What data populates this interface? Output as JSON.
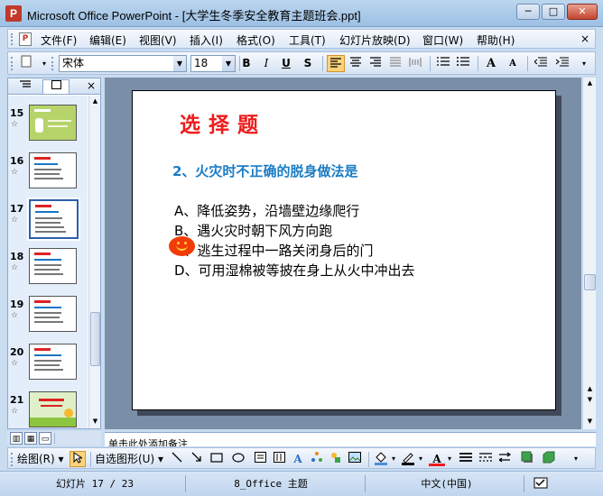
{
  "window": {
    "title": "Microsoft Office PowerPoint - [大学生冬季安全教育主题班会.ppt]",
    "app_icon_letter": "P",
    "minimize": "─",
    "maximize": "□",
    "close": "✕"
  },
  "menubar": {
    "items": [
      "文件(F)",
      "编辑(E)",
      "视图(V)",
      "插入(I)",
      "格式(O)",
      "工具(T)",
      "幻灯片放映(D)",
      "窗口(W)",
      "帮助(H)"
    ],
    "close_glyph": "×"
  },
  "format_toolbar": {
    "font_name": "宋体",
    "font_size": "18",
    "bold": "B",
    "italic": "I",
    "underline": "U",
    "shadow": "S",
    "grow_font": "A",
    "shrink_font": "A"
  },
  "outline_pane": {
    "close_glyph": "×",
    "slides": [
      {
        "number": "15"
      },
      {
        "number": "16"
      },
      {
        "number": "17",
        "selected": true
      },
      {
        "number": "18"
      },
      {
        "number": "19"
      },
      {
        "number": "20"
      },
      {
        "number": "21"
      }
    ],
    "star_glyph": "☆"
  },
  "slide": {
    "title": "选择题",
    "question": "2、火灾时不正确的脱身做法是",
    "options": [
      "A、降低姿势，沿墙壁边缘爬行",
      "B、遇火灾时朝下风方向跑",
      "C、逃生过程中一路关闭身后的门",
      "D、可用湿棉被等披在身上从火中冲出去"
    ],
    "colors": {
      "title": "#ee1c1c",
      "question": "#1a7cc5",
      "smiley": "#f13c0a"
    }
  },
  "notes": {
    "placeholder": "单击此处添加备注"
  },
  "drawing_toolbar": {
    "draw_label": "绘图(R)",
    "autoshapes_label": "自选图形(U)"
  },
  "statusbar": {
    "slide_position": "幻灯片 17 / 23",
    "design": "8_Office 主题",
    "language": "中文(中国)"
  }
}
